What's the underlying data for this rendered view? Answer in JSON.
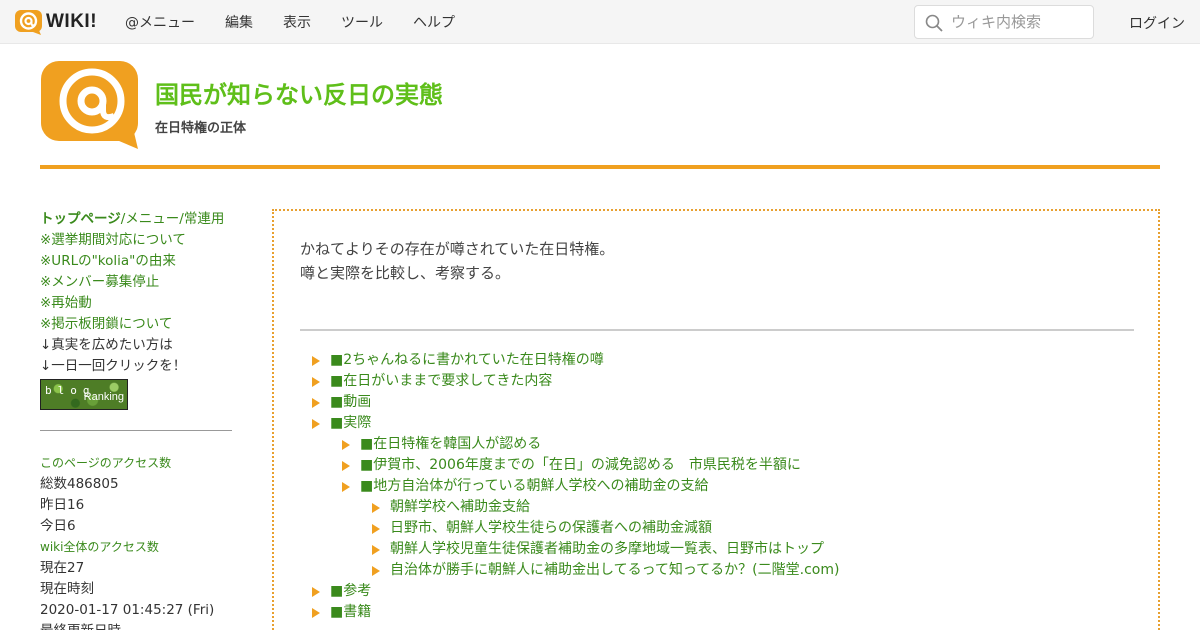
{
  "topbar": {
    "logo_text": "WIKI!",
    "nav": [
      "@メニュー",
      "編集",
      "表示",
      "ツール",
      "ヘルプ"
    ],
    "search_placeholder": "ウィキ内検索",
    "login": "ログイン"
  },
  "header": {
    "title": "国民が知らない反日の実態",
    "subtitle": "在日特権の正体"
  },
  "sidebar": {
    "top_link": "トップページ",
    "top_rest": "/メニュー/常連用",
    "links": [
      "※選挙期間対応について",
      "※URLの\"kolia\"の由来",
      "※メンバー募集停止",
      "※再始動",
      "※掲示板閉鎖について"
    ],
    "notes": [
      "↓真実を広めたい方は",
      "↓一日一回クリックを！"
    ],
    "banner_top": "blog",
    "banner_bottom": "Ranking",
    "access_label": "このページのアクセス数",
    "total": "総数486805",
    "yesterday": "昨日16",
    "today": "今日6",
    "wiki_access_label": "wiki全体のアクセス数",
    "now_count": "現在27",
    "now_time_label": "現在時刻",
    "now_time": "2020-01-17 01:45:27 (Fri)",
    "last_updated_label": "最終更新日時"
  },
  "main": {
    "intro": [
      "かねてよりその存在が噂されていた在日特権。",
      "噂と実際を比較し、考察する。"
    ],
    "toc": [
      {
        "level": 1,
        "text": "■2ちゃんねるに書かれていた在日特権の噂"
      },
      {
        "level": 1,
        "text": "■在日がいままで要求してきた内容"
      },
      {
        "level": 1,
        "text": "■動画"
      },
      {
        "level": 1,
        "text": "■実際"
      },
      {
        "level": 2,
        "text": "■在日特権を韓国人が認める"
      },
      {
        "level": 2,
        "text": "■伊賀市、2006年度までの「在日」の減免認める　市県民税を半額に"
      },
      {
        "level": 2,
        "text": "■地方自治体が行っている朝鮮人学校への補助金の支給"
      },
      {
        "level": 3,
        "text": "朝鮮学校へ補助金支給"
      },
      {
        "level": 3,
        "text": "日野市、朝鮮人学校生徒らの保護者への補助金減額"
      },
      {
        "level": 3,
        "text": "朝鮮人学校児童生徒保護者補助金の多摩地域一覧表、日野市はトップ"
      },
      {
        "level": 3,
        "text": "自治体が勝手に朝鮮人に補助金出してるって知ってるか？(二階堂.com)"
      },
      {
        "level": 1,
        "text": "■参考"
      },
      {
        "level": 1,
        "text": "■書籍"
      }
    ]
  },
  "colors": {
    "accent_orange": "#f0a020",
    "link_green": "#3a8a1c",
    "title_green": "#5fbf1a"
  }
}
